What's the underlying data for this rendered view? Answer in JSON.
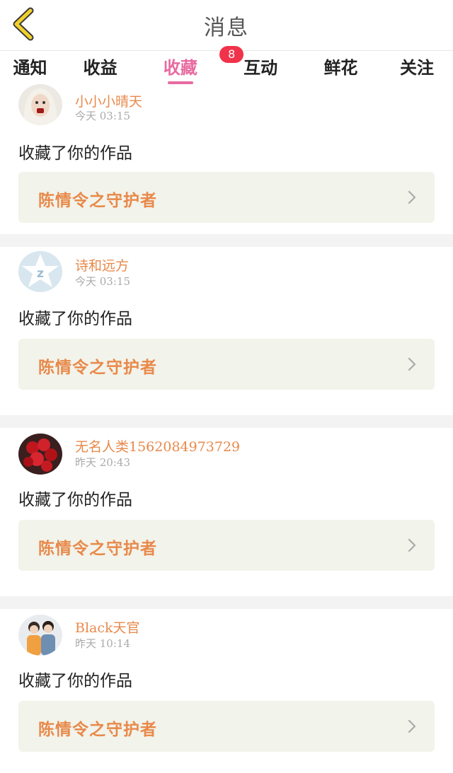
{
  "header": {
    "title": "消息",
    "back_icon": "chevron-left-icon",
    "back_color": "#f2d02a"
  },
  "tabs": [
    {
      "label": "通知"
    },
    {
      "label": "收益"
    },
    {
      "label": "收藏",
      "badge": "8",
      "active": true
    },
    {
      "label": "互动"
    },
    {
      "label": "鲜花"
    },
    {
      "label": "关注"
    }
  ],
  "messages": [
    {
      "name": "小小小晴天",
      "time": "今天 03:15",
      "action": "收藏了你的作品",
      "work": "陈情令之守护者",
      "avatar": "girl-portrait-avatar"
    },
    {
      "name": "诗和远方",
      "time": "今天 03:15",
      "action": "收藏了你的作品",
      "work": "陈情令之守护者",
      "avatar": "qq-star-avatar"
    },
    {
      "name": "无名人类1562084973729",
      "time": "昨天 20:43",
      "action": "收藏了你的作品",
      "work": "陈情令之守护者",
      "avatar": "red-roses-avatar"
    },
    {
      "name": "Black天官",
      "time": "昨天 10:14",
      "action": "收藏了你的作品",
      "work": "陈情令之守护者",
      "avatar": "couple-photo-avatar"
    }
  ],
  "colors": {
    "accent_pink": "#e86aa0",
    "name_orange": "#e8894a",
    "badge_red": "#f0334a",
    "card_bg": "#f2f3ea"
  }
}
